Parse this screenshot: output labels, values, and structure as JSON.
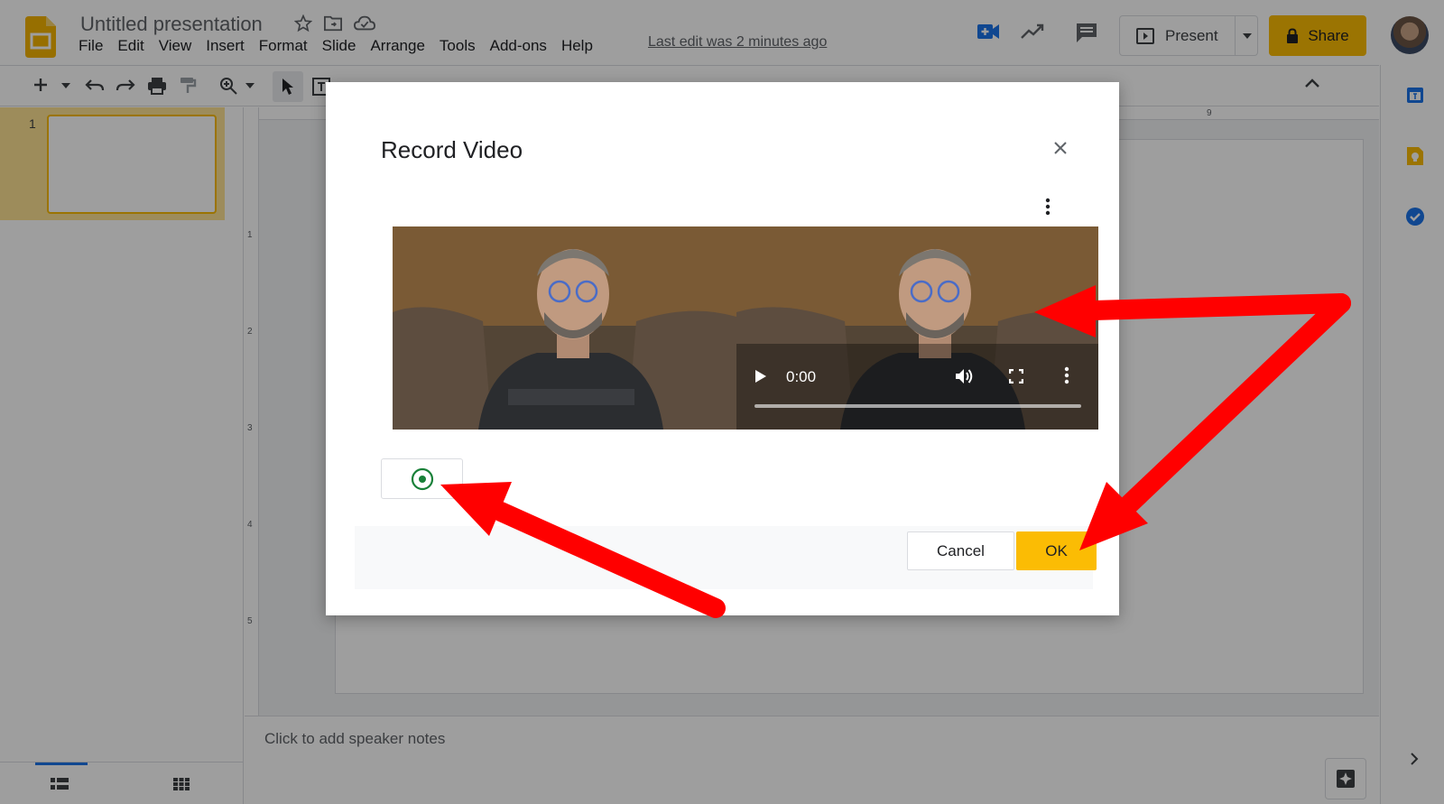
{
  "app": {
    "title": "Untitled presentation",
    "menu": [
      "File",
      "Edit",
      "View",
      "Insert",
      "Format",
      "Slide",
      "Arrange",
      "Tools",
      "Add-ons",
      "Help"
    ],
    "last_edit": "Last edit was 2 minutes ago",
    "present_label": "Present",
    "share_label": "Share",
    "accent_color": "#fbbc04"
  },
  "filmstrip": {
    "slides": [
      {
        "number": "1"
      }
    ]
  },
  "canvas": {
    "vruler_numbers": [
      "1",
      "2",
      "3",
      "4",
      "5"
    ],
    "hruler_number": "9"
  },
  "notes": {
    "placeholder": "Click to add speaker notes"
  },
  "dialog": {
    "title": "Record Video",
    "video_time": "0:00",
    "cancel_label": "Cancel",
    "ok_label": "OK",
    "annotation_color": "#ff0000"
  }
}
